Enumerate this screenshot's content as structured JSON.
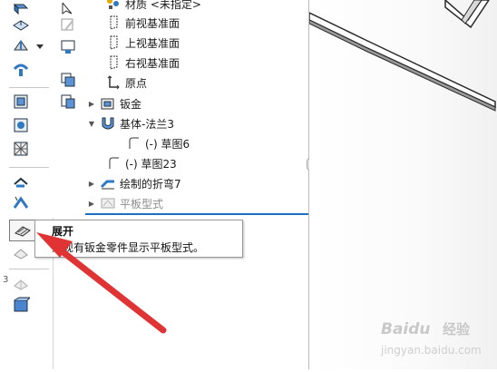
{
  "feature_tree": {
    "material_label": "材质 <未指定>",
    "front_plane": "前视基准面",
    "top_plane": "上视基准面",
    "right_plane": "右视基准面",
    "origin": "原点",
    "sheet_metal": "钣金",
    "base_flange": "基体-法兰3",
    "sketch6": "(-) 草图6",
    "sketch23": "(-) 草图23",
    "sketched_bend": "绘制的折弯7",
    "flat_pattern": "平板型式"
  },
  "tooltip": {
    "title": "展开",
    "description": "为现有钣金零件显示平板型式。"
  },
  "toolbar": {
    "left_number": "3"
  },
  "watermark": {
    "brand": "Baidu",
    "product": "经验",
    "url": "jingyan.baidu.com"
  },
  "colors": {
    "selection_line": "#1e6fbf",
    "annotation_arrow": "#e03434",
    "toolbar_blue": "#2f78c4"
  }
}
